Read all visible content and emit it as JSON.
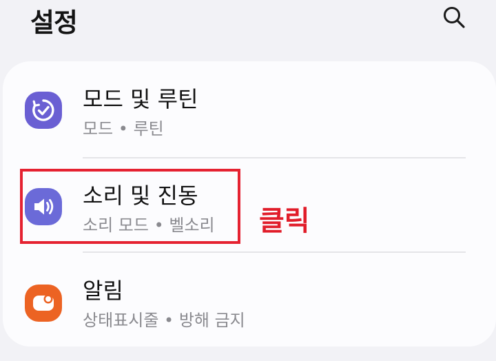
{
  "header": {
    "title": "설정",
    "search_icon": "search-icon"
  },
  "settings_items": [
    {
      "title": "모드 및 루틴",
      "subtitle": "모드 • 루틴",
      "icon": "modes-routines-icon",
      "icon_color": "#6a5fd3"
    },
    {
      "title": "소리 및 진동",
      "subtitle": "소리 모드 • 벨소리",
      "icon": "speaker-volume-icon",
      "icon_color": "#6b6ad8"
    },
    {
      "title": "알림",
      "subtitle": "상태표시줄 • 방해 금지",
      "icon": "notification-icon",
      "icon_color": "#ec6323"
    }
  ],
  "annotation": {
    "label": "클릭",
    "color": "#e11d2a"
  }
}
